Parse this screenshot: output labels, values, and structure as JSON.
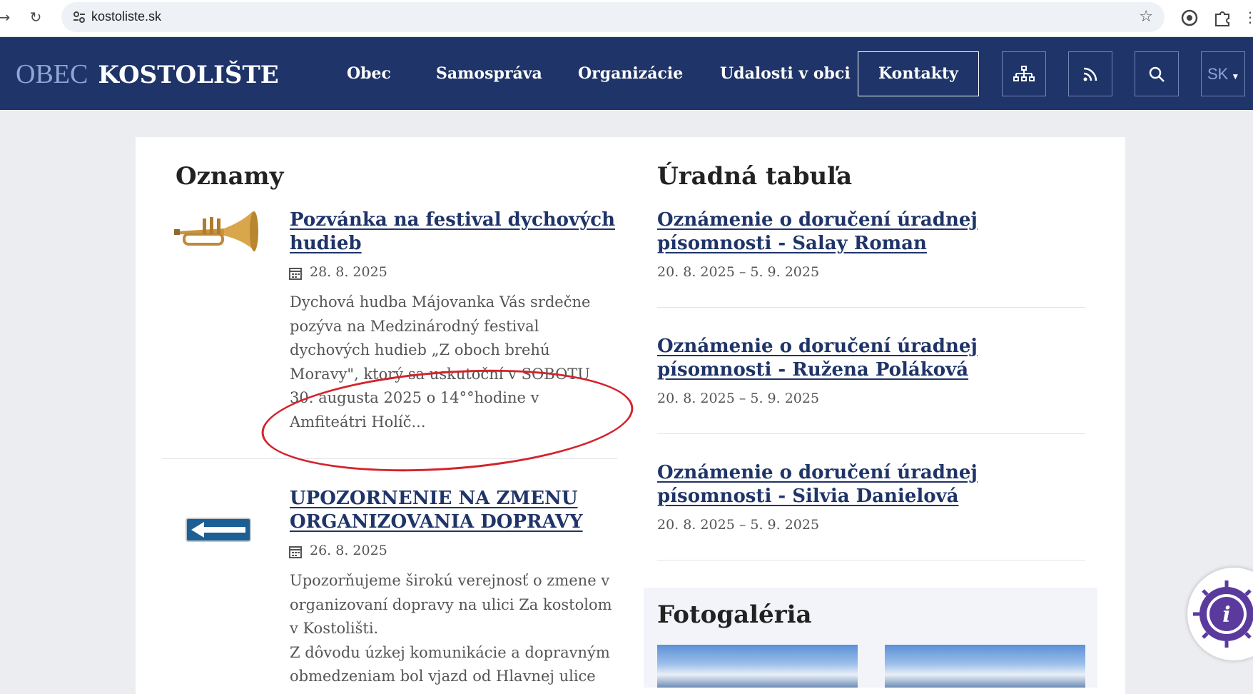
{
  "browser": {
    "url": "kostoliste.sk"
  },
  "header": {
    "logo_light": "OBEC",
    "logo_bold": "KOSTOLIŠTE",
    "menu": [
      "Obec",
      "Samospráva",
      "Organizácie",
      "Udalosti v obci"
    ],
    "contacts_label": "Kontakty",
    "language": "SK"
  },
  "announcements": {
    "title": "Oznamy",
    "items": [
      {
        "title": "Pozvánka na festival dychových hudieb",
        "date": "28. 8. 2025",
        "text": "Dychová hudba Májovanka Vás srdečne pozýva na Medzinárodný festival dychových hudieb „Z oboch brehú Moravy\", ktorý sa uskutoční v SOBOTU 30. augusta 2025 o 14°°hodine v Amfiteátri Holíč..."
      },
      {
        "title": "UPOZORNENIE NA ZMENU ORGANIZOVANIA DOPRAVY",
        "date": "26. 8. 2025",
        "text": "Upozorňujeme širokú verejnosť o zmene v organizovaní dopravy na ulici Za kostolom v Kostolišti.\nZ dôvodu úzkej komunikácie a dopravným obmedzeniam bol vjazd od Hlavnej ulice"
      }
    ]
  },
  "official_board": {
    "title": "Úradná tabuľa",
    "items": [
      {
        "title": "Oznámenie o doručení úradnej písomnosti - Salay Roman",
        "dates": "20. 8. 2025 – 5. 9. 2025"
      },
      {
        "title": "Oznámenie o doručení úradnej písomnosti - Ružena Poláková",
        "dates": "20. 8. 2025 – 5. 9. 2025"
      },
      {
        "title": "Oznámenie o doručení úradnej písomnosti - Silvia Danielová",
        "dates": "20. 8. 2025 – 5. 9. 2025"
      }
    ]
  },
  "gallery": {
    "title": "Fotogaléria"
  },
  "colors": {
    "brand": "#1f3468",
    "annotation": "#d4232b"
  }
}
